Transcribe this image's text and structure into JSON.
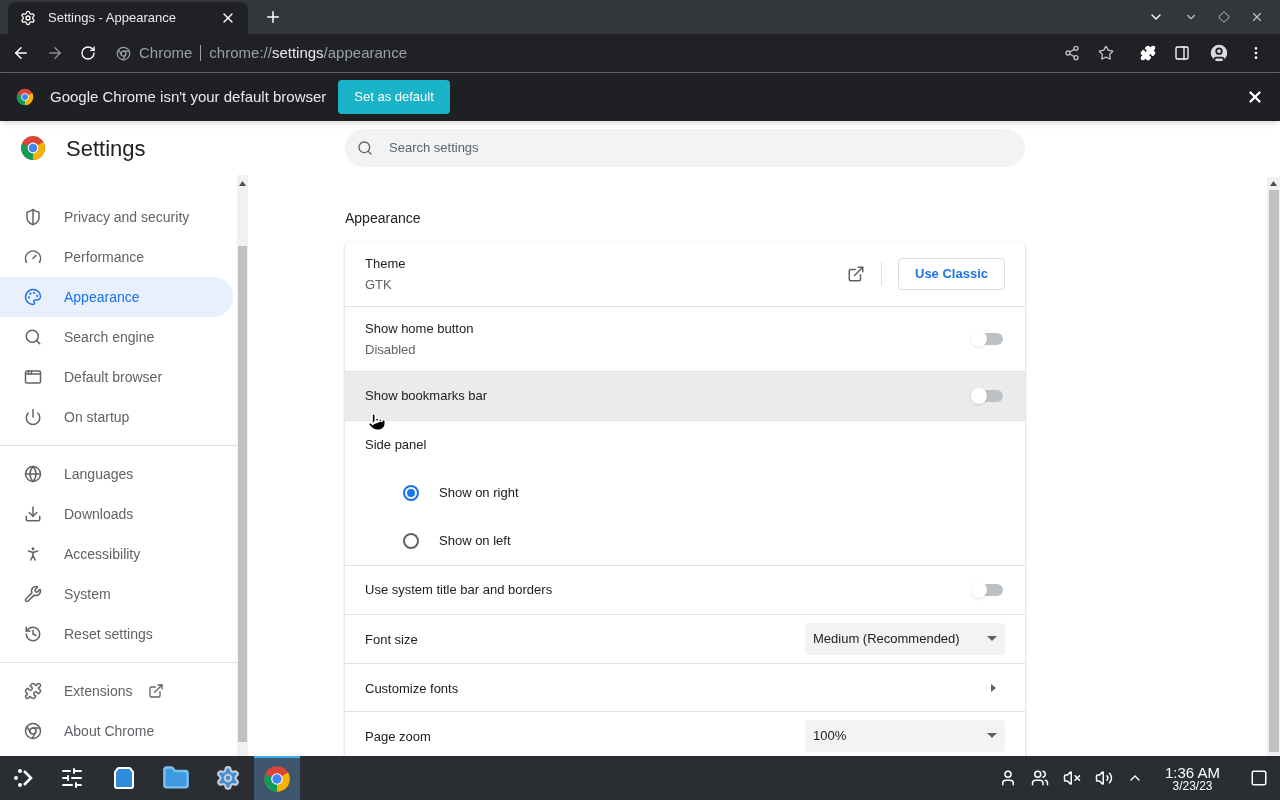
{
  "tab": {
    "title": "Settings - Appearance"
  },
  "address_bar": {
    "site": "Chrome",
    "url_prefix": "chrome://",
    "url_host": "settings",
    "url_path": "/appearance"
  },
  "infobar": {
    "message": "Google Chrome isn't your default browser",
    "button": "Set as default"
  },
  "sidebar": {
    "title": "Settings",
    "items": [
      {
        "label": "Privacy and security",
        "selected": false
      },
      {
        "label": "Performance",
        "selected": false
      },
      {
        "label": "Appearance",
        "selected": true
      },
      {
        "label": "Search engine",
        "selected": false
      },
      {
        "label": "Default browser",
        "selected": false
      },
      {
        "label": "On startup",
        "selected": false
      },
      {
        "label": "Languages",
        "selected": false
      },
      {
        "label": "Downloads",
        "selected": false
      },
      {
        "label": "Accessibility",
        "selected": false
      },
      {
        "label": "System",
        "selected": false
      },
      {
        "label": "Reset settings",
        "selected": false
      },
      {
        "label": "Extensions",
        "selected": false
      },
      {
        "label": "About Chrome",
        "selected": false
      }
    ]
  },
  "search": {
    "placeholder": "Search settings"
  },
  "section": {
    "title": "Appearance",
    "rows": [
      {
        "kind": "link-button",
        "label": "Theme",
        "sublabel": "GTK",
        "button": "Use Classic"
      },
      {
        "kind": "toggle",
        "label": "Show home button",
        "sublabel": "Disabled",
        "on": false,
        "hovered": false
      },
      {
        "kind": "toggle",
        "label": "Show bookmarks bar",
        "on": false,
        "hovered": true
      },
      {
        "kind": "radio-group",
        "label": "Side panel",
        "options": [
          {
            "label": "Show on right",
            "selected": true
          },
          {
            "label": "Show on left",
            "selected": false
          }
        ]
      },
      {
        "kind": "toggle",
        "label": "Use system title bar and borders",
        "on": false,
        "hovered": false
      },
      {
        "kind": "select",
        "label": "Font size",
        "value": "Medium (Recommended)"
      },
      {
        "kind": "submenu",
        "label": "Customize fonts"
      },
      {
        "kind": "select",
        "label": "Page zoom",
        "value": "100%"
      }
    ]
  },
  "taskbar": {
    "time": "1:36 AM",
    "date": "3/23/23"
  }
}
